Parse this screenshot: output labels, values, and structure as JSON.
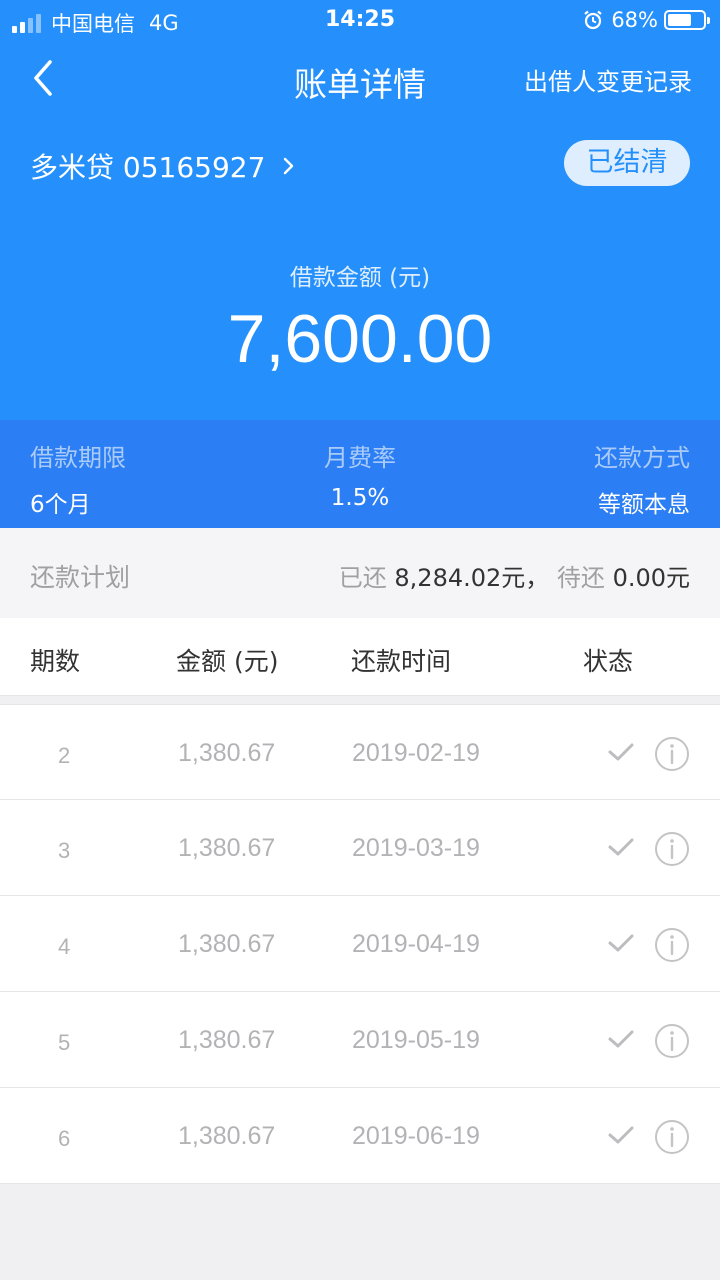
{
  "status_bar": {
    "carrier": "中国电信",
    "network": "4G",
    "time": "14:25",
    "battery": "68%",
    "battery_level": 0.68
  },
  "nav": {
    "title": "账单详情",
    "right_action": "出借人变更记录"
  },
  "loan": {
    "name": "多米贷 05165927",
    "status_badge": "已结清",
    "amount_label": "借款金额 (元)",
    "amount": "7,600.00"
  },
  "terms": {
    "period_label": "借款期限",
    "period_value": "6个月",
    "rate_label": "月费率",
    "rate_value": "1.5%",
    "method_label": "还款方式",
    "method_value": "等额本息"
  },
  "plan": {
    "title": "还款计划",
    "paid_label": "已还",
    "paid_value": "8,284.02元，",
    "pending_label": "待还",
    "pending_value": "0.00元"
  },
  "table": {
    "headers": [
      "期数",
      "金额 (元)",
      "还款时间",
      "状态"
    ],
    "rows": [
      {
        "no": "2",
        "amount": "1,380.67",
        "date": "2019-02-19"
      },
      {
        "no": "3",
        "amount": "1,380.67",
        "date": "2019-03-19"
      },
      {
        "no": "4",
        "amount": "1,380.67",
        "date": "2019-04-19"
      },
      {
        "no": "5",
        "amount": "1,380.67",
        "date": "2019-05-19"
      },
      {
        "no": "6",
        "amount": "1,380.67",
        "date": "2019-06-19"
      }
    ]
  },
  "colors": {
    "primary": "#2590fb",
    "terms_bar": "#2b7ef3",
    "muted_text": "#b3b3b6"
  }
}
